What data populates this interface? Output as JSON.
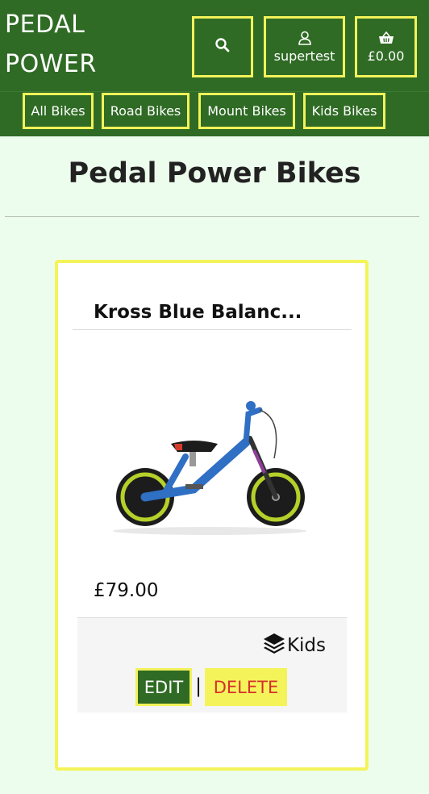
{
  "header": {
    "brand_line1": "PEDAL",
    "brand_line2": "POWER",
    "account_label": "supertest",
    "basket_total": "£0.00",
    "icons": [
      "search-icon",
      "user-icon",
      "basket-icon"
    ]
  },
  "nav": {
    "items": [
      {
        "label": "All Bikes"
      },
      {
        "label": "Road Bikes"
      },
      {
        "label": "Mount Bikes"
      },
      {
        "label": "Kids Bikes"
      }
    ]
  },
  "main": {
    "title": "Pedal Power Bikes"
  },
  "product": {
    "name": "Kross Blue Balanc...",
    "price": "£79.00",
    "category": "Kids",
    "category_icon": "layers-icon",
    "edit_label": "EDIT",
    "separator": "|",
    "delete_label": "DELETE"
  },
  "colors": {
    "header_bg": "#2f6b24",
    "accent_yellow": "#f2f25a",
    "page_bg": "#edfded",
    "delete_text": "#d6302b"
  }
}
